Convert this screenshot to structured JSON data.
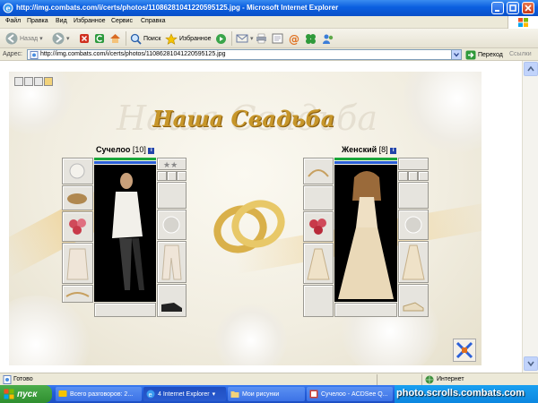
{
  "window": {
    "title": "http://img.combats.com/i/certs/photos/11086281041220595125.jpg - Microsoft Internet Explorer"
  },
  "menu": [
    "Файл",
    "Правка",
    "Вид",
    "Избранное",
    "Сервис",
    "Справка"
  ],
  "toolbar": {
    "back_label": "Назад",
    "search_label": "Поиск",
    "favorites_label": "Избранное"
  },
  "address": {
    "label": "Адрес:",
    "url": "http://img.combats.com/i/certs/photos/11086281041220595125.jpg",
    "go_label": "Переход",
    "links_label": "Ссылки"
  },
  "photo": {
    "heading": "Наша Свадьба",
    "left_character": {
      "name": "Сучелоо",
      "level": "[10]"
    },
    "right_character": {
      "name": "Женский",
      "level": "[8]"
    }
  },
  "status": {
    "text": "Готово",
    "zone": "Интернет"
  },
  "taskbar": {
    "start_label": "пуск",
    "tasks": [
      "Всего разговоров: 2...",
      "4 Internet Explorer",
      "Мои рисунки",
      "Сучелоо - ACDSee Q..."
    ],
    "watermark": "photo.scrolls.combats.com"
  },
  "colors": {
    "titlebar_blue": "#0b5fe0",
    "taskbar_blue": "#245edb",
    "start_green": "#2f8f2f",
    "heading_gold": "#c7962a"
  }
}
